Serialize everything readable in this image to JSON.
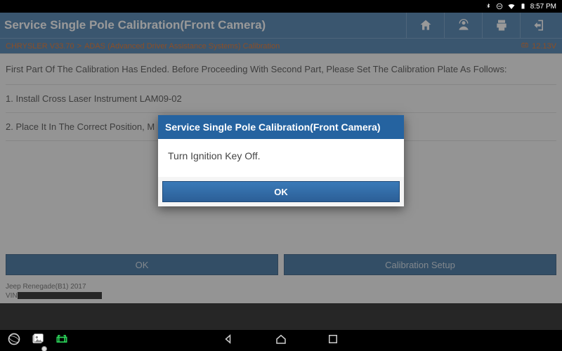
{
  "statusbar": {
    "time": "8:57 PM",
    "battery_glyph": "▮",
    "bt_glyph": "᚛",
    "wifi_glyph": "▾"
  },
  "header": {
    "title": "Service Single Pole Calibration(Front Camera)"
  },
  "breadcrumb": {
    "vehicle": "CHRYSLER V33.70",
    "sep": ">",
    "path": "ADAS (Advanced Driver Assistance Systems) Calibration",
    "voltage": "12.13V"
  },
  "instructions": {
    "intro": "First Part Of The Calibration Has Ended. Before Proceeding With Second Part, Please Set The Calibration Plate As Follows:",
    "step1": "1. Install Cross Laser Instrument LAM09-02",
    "step2": "2. Place It In The Correct Position, M"
  },
  "bottom": {
    "ok": "OK",
    "calib_setup": "Calibration Setup"
  },
  "vehicle_footer": {
    "model": "Jeep Renegade(B1) 2017",
    "vin_label": "VIN"
  },
  "dialog": {
    "title": "Service Single Pole Calibration(Front Camera)",
    "body": "Turn Ignition Key Off.",
    "ok": "OK"
  }
}
